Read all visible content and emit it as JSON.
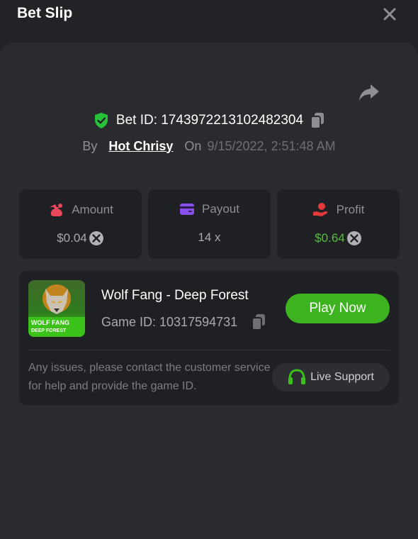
{
  "header": {
    "title": "Bet Slip"
  },
  "bet": {
    "id_label": "Bet ID: 1743972213102482304",
    "by_label": "By",
    "user": "Hot Chrisy",
    "on_label": "On",
    "date": "9/15/2022, 2:51:48 AM"
  },
  "stats": {
    "amount": {
      "label": "Amount",
      "value": "$0.04"
    },
    "payout": {
      "label": "Payout",
      "value": "14 x"
    },
    "profit": {
      "label": "Profit",
      "value": "$0.64"
    }
  },
  "game": {
    "name": "Wolf Fang - Deep Forest",
    "id_label": "Game ID: 10317594731",
    "play_label": "Play Now",
    "thumb_line1": "WOLF FANG",
    "thumb_line2": "DEEP FOREST"
  },
  "support": {
    "help_text": "Any issues, please contact the customer service for help and provide the game ID.",
    "live_label": "Live Support"
  },
  "colors": {
    "background": "#222326",
    "panel": "#2a2b2f",
    "card": "#1f2023",
    "accent_green": "#3cb31f",
    "profit_green": "#53c13a",
    "amount_icon": "#e8485a",
    "payout_icon": "#8a4ff0",
    "profit_icon": "#e23a3a"
  },
  "icons": {
    "close": "close-icon",
    "share": "share-arrow-icon",
    "verified": "shield-check-icon",
    "copy": "copy-icon",
    "amount": "money-bag-icon",
    "payout": "wallet-icon",
    "profit": "hand-coin-icon",
    "currency": "coin-x-icon",
    "support": "headset-icon"
  }
}
